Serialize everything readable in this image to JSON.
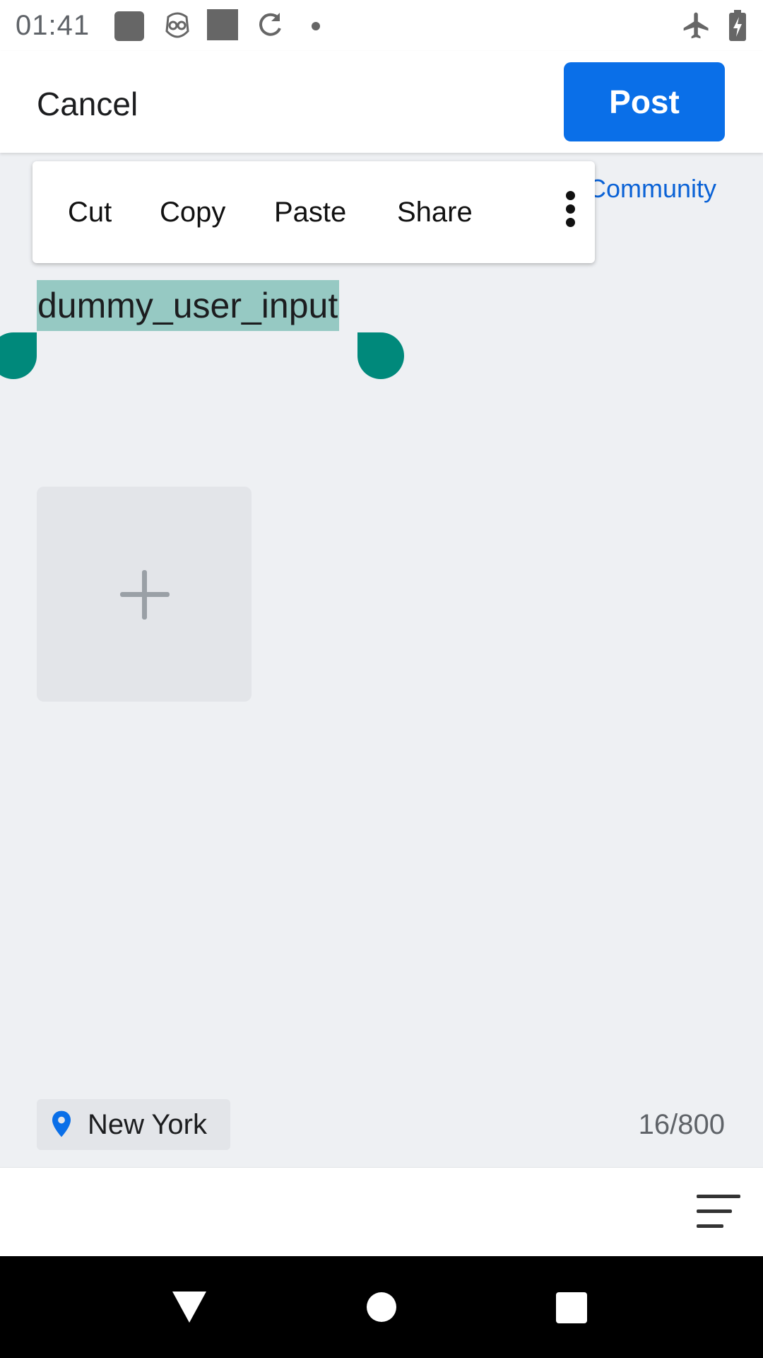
{
  "status_bar": {
    "time": "01:41",
    "icons": [
      "square-app-icon",
      "owl-icon",
      "square-app-icon",
      "sync-icon",
      "dot-icon",
      "airplane-mode-icon",
      "battery-charging-icon"
    ]
  },
  "header": {
    "cancel_label": "Cancel",
    "post_label": "Post",
    "community_label": "Community"
  },
  "context_menu": {
    "items": [
      "Cut",
      "Copy",
      "Paste",
      "Share"
    ],
    "more_icon": "more-vertical-icon"
  },
  "editor": {
    "text_value": "dummy_user_input"
  },
  "media": {
    "add_icon": "plus-icon"
  },
  "footer": {
    "location": "New York",
    "char_count": "16/800"
  },
  "toolbar": {
    "menu_icon": "menu-icon"
  },
  "colors": {
    "accent": "#0a6fe8",
    "selection": "#96c9c3",
    "handle": "#00897b",
    "link": "#0a62d6"
  }
}
